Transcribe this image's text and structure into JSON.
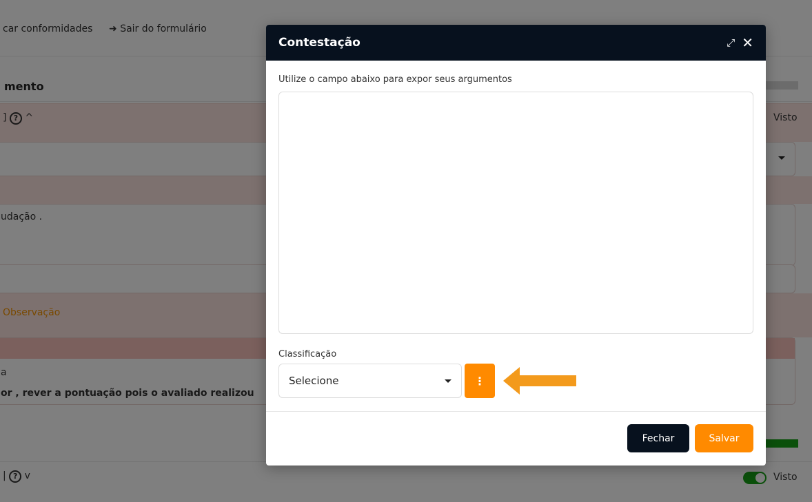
{
  "background": {
    "top_links": [
      "car conformidades",
      "Sair do formulário"
    ],
    "section_title": "mento",
    "visto_label": "Visto",
    "text_udacao": "udação .",
    "observacao_link": "Observação",
    "text_a": "a",
    "text_rever": "or , rever a pontuação pois o avaliado realizou",
    "visto_label_2": "Visto"
  },
  "modal": {
    "title": "Contestação",
    "args_label": "Utilize o campo abaixo para expor seus argumentos",
    "textarea_value": "",
    "classification_label": "Classificação",
    "select_value": "Selecione",
    "kebab_glyph": "⋮",
    "close_button": "Fechar",
    "save_button": "Salvar"
  },
  "colors": {
    "header_bg": "#07111e",
    "accent": "#ff8a00",
    "arrow": "#f39a1c"
  }
}
